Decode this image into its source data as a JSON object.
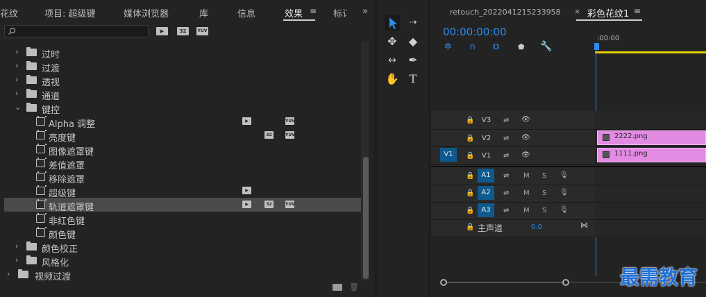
{
  "effects_panel": {
    "tabs": [
      "花纹",
      "项目: 超级键",
      "媒体浏览器",
      "库",
      "信息",
      "效果",
      "标订"
    ],
    "active_tab": "效果",
    "search": {
      "value": "",
      "placeholder": ""
    },
    "header_badges": [
      "32",
      "YUV"
    ],
    "items": [
      {
        "type": "folder",
        "label": "过时",
        "level": 1
      },
      {
        "type": "folder",
        "label": "过渡",
        "level": 1
      },
      {
        "type": "folder",
        "label": "透视",
        "level": 1
      },
      {
        "type": "folder",
        "label": "通道",
        "level": 1
      },
      {
        "type": "folder",
        "label": "键控",
        "level": 1,
        "expanded": true
      },
      {
        "type": "effect",
        "label": "Alpha 调整",
        "badges": [
          "accel",
          "yuv"
        ]
      },
      {
        "type": "effect",
        "label": "亮度键",
        "badges": [
          "32",
          "yuv"
        ]
      },
      {
        "type": "effect",
        "label": "图像遮罩键",
        "badges": []
      },
      {
        "type": "effect",
        "label": "差值遮罩",
        "badges": []
      },
      {
        "type": "effect",
        "label": "移除遮罩",
        "badges": []
      },
      {
        "type": "effect",
        "label": "超级键",
        "badges": [
          "accel"
        ]
      },
      {
        "type": "effect",
        "label": "轨道遮罩键",
        "badges": [
          "accel",
          "32",
          "yuv"
        ],
        "selected": true
      },
      {
        "type": "effect",
        "label": "非红色键",
        "badges": []
      },
      {
        "type": "effect",
        "label": "颜色键",
        "badges": []
      },
      {
        "type": "folder",
        "label": "颜色校正",
        "level": 1
      },
      {
        "type": "folder",
        "label": "风格化",
        "level": 1
      },
      {
        "type": "folder",
        "label": "视频过渡",
        "level": 0
      }
    ]
  },
  "timeline": {
    "tabs": [
      "retouch_20220412152339​58",
      "彩色花纹1"
    ],
    "timecode": "00:00:00:00",
    "ruler_label": ":00:00",
    "video_tracks": [
      {
        "name": "V3"
      },
      {
        "name": "V2"
      },
      {
        "name": "V1",
        "source": "V1"
      }
    ],
    "audio_tracks": [
      {
        "name": "A1",
        "source": "A1",
        "m": "M",
        "s": "S"
      },
      {
        "name": "A2",
        "source": "A2",
        "m": "M",
        "s": "S"
      },
      {
        "name": "A3",
        "source": "A3",
        "m": "M",
        "s": "S"
      }
    ],
    "master": {
      "label": "主声道",
      "value": "0.0"
    },
    "clips": [
      {
        "name": "2222.png",
        "track": "V2"
      },
      {
        "name": "1111.png",
        "track": "V1"
      }
    ]
  },
  "watermark": "最需教育",
  "colors": {
    "accent": "#2d8ceb",
    "clip": "#e38ae3",
    "source": "#0e5a8e"
  }
}
